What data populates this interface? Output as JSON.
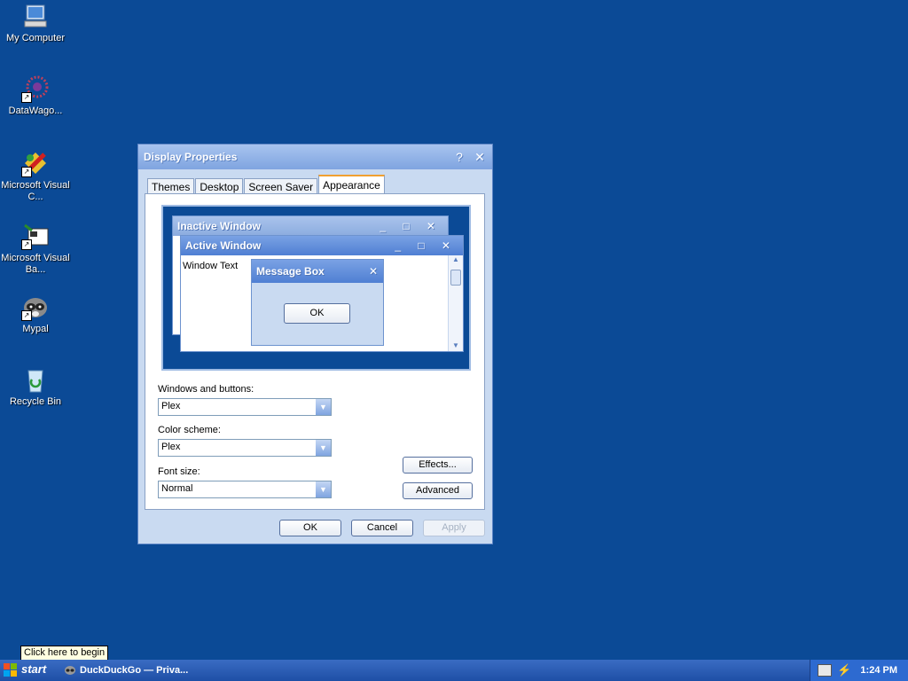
{
  "desktop": {
    "icons": [
      {
        "label": "My Computer"
      },
      {
        "label": "DataWago..."
      },
      {
        "label": "Microsoft Visual C..."
      },
      {
        "label": "Microsoft Visual Ba..."
      },
      {
        "label": "Mypal"
      },
      {
        "label": "Recycle Bin"
      }
    ]
  },
  "dialog": {
    "title": "Display Properties",
    "help_glyph": "?",
    "close_glyph": "✕",
    "tabs": [
      {
        "label": "Themes"
      },
      {
        "label": "Desktop"
      },
      {
        "label": "Screen Saver"
      },
      {
        "label": "Appearance",
        "active": true
      }
    ],
    "preview": {
      "inactive_title": "Inactive Window",
      "active_title": "Active Window",
      "window_text": "Window Text",
      "message_box_title": "Message Box",
      "message_ok": "OK"
    },
    "windows_and_buttons": {
      "label": "Windows and buttons:",
      "value": "Plex"
    },
    "color_scheme": {
      "label": "Color scheme:",
      "value": "Plex"
    },
    "font_size": {
      "label": "Font size:",
      "value": "Normal"
    },
    "effects_label": "Effects...",
    "advanced_label": "Advanced",
    "ok_label": "OK",
    "cancel_label": "Cancel",
    "apply_label": "Apply"
  },
  "taskbar": {
    "start_label": "start",
    "task_label": "DuckDuckGo — Priva...",
    "clock": "1:24 PM",
    "tooltip": "Click here to begin"
  },
  "colors": {
    "desktop": "#0b4a96",
    "title_active": "#4f7fd3",
    "title_inactive": "#8cacdf"
  }
}
